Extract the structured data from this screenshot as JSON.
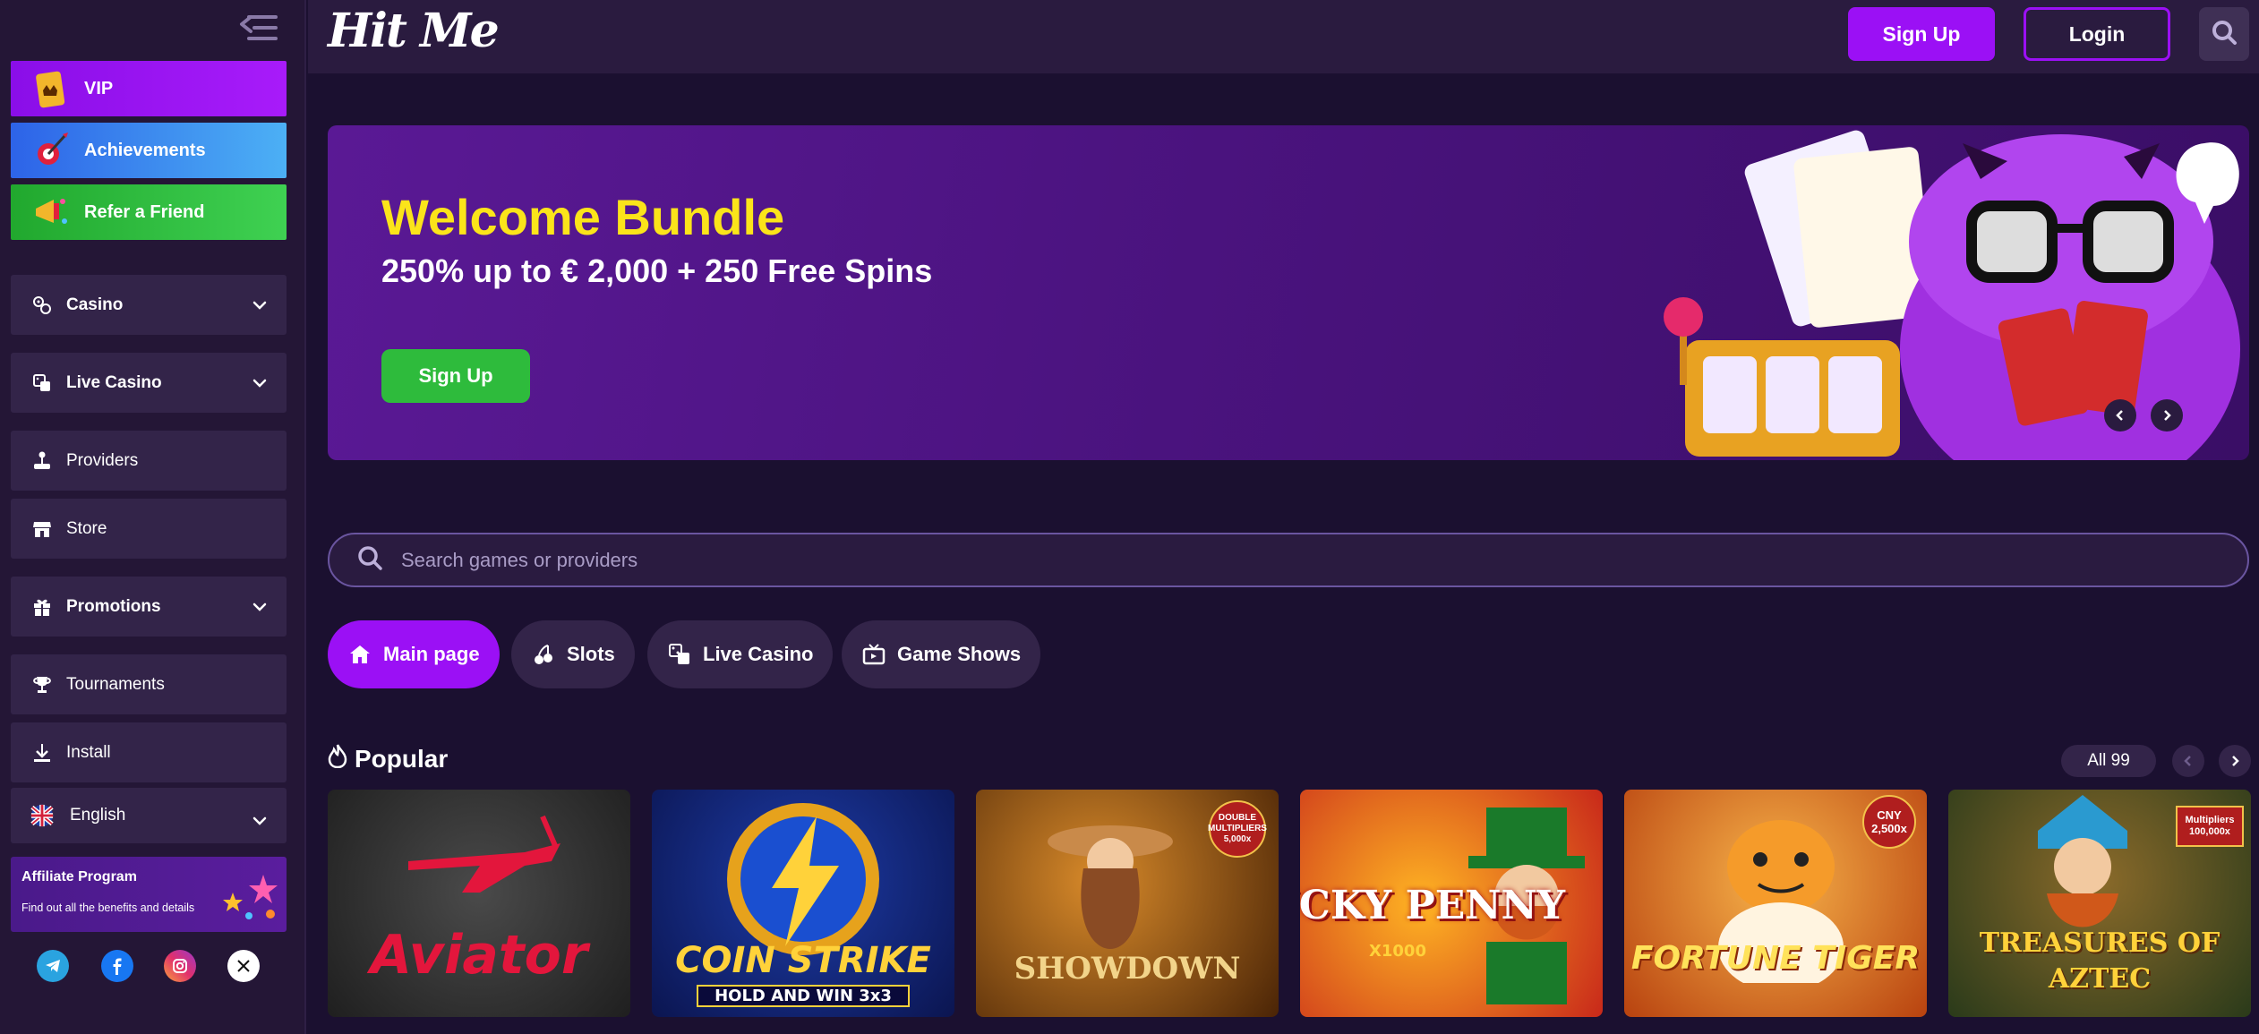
{
  "brand": {
    "logo_text": "Hit Me"
  },
  "header": {
    "signup_label": "Sign Up",
    "login_label": "Login",
    "search_icon": "search-icon"
  },
  "sidebar": {
    "promos": [
      {
        "label": "VIP",
        "icon": "vip-ticket-icon",
        "color": "#9b10f5"
      },
      {
        "label": "Achievements",
        "icon": "darts-icon",
        "color": "#3b8cf0"
      },
      {
        "label": "Refer a Friend",
        "icon": "megaphone-icon",
        "color": "#2ebb3c"
      }
    ],
    "nav": [
      {
        "label": "Casino",
        "icon": "casino-chips-icon",
        "expandable": true
      },
      {
        "label": "Live Casino",
        "icon": "dice-icon",
        "expandable": true
      },
      {
        "label": "Providers",
        "icon": "joystick-icon",
        "expandable": false
      },
      {
        "label": "Store",
        "icon": "store-icon",
        "expandable": false
      },
      {
        "label": "Promotions",
        "icon": "gift-icon",
        "expandable": true
      },
      {
        "label": "Tournaments",
        "icon": "trophy-icon",
        "expandable": false
      },
      {
        "label": "Install",
        "icon": "download-icon",
        "expandable": false
      }
    ],
    "language": {
      "label": "English",
      "icon": "uk-flag-icon"
    },
    "affiliate": {
      "title": "Affiliate Program",
      "subtitle": "Find out all the benefits and details"
    },
    "socials": [
      "telegram-icon",
      "facebook-icon",
      "instagram-icon",
      "x-icon"
    ]
  },
  "banner": {
    "title": "Welcome Bundle",
    "subtitle": "250% up to € 2,000 + 250 Free Spins",
    "cta": "Sign Up"
  },
  "search": {
    "placeholder": "Search games or providers"
  },
  "tabs": [
    {
      "label": "Main page",
      "icon": "home-icon",
      "active": true
    },
    {
      "label": "Slots",
      "icon": "cherries-icon",
      "active": false
    },
    {
      "label": "Live Casino",
      "icon": "dice-icon",
      "active": false
    },
    {
      "label": "Game Shows",
      "icon": "tv-icon",
      "active": false
    }
  ],
  "popular": {
    "title": "Popular",
    "all_label": "All 99",
    "games": [
      {
        "name": "Aviator"
      },
      {
        "name": "COIN STRIKE",
        "tagline": "HOLD AND WIN 3x3"
      },
      {
        "name": "SHOWDOWN",
        "badge": "DOUBLE MULTIPLIERS 5,000x"
      },
      {
        "name": "LUCKY PENNY",
        "tagline": "X1000"
      },
      {
        "name": "FORTUNE TIGER",
        "badge": "CNY 2,500x"
      },
      {
        "name": "TREASURES OF AZTEC",
        "badge": "Multipliers 100,000x"
      }
    ]
  },
  "colors": {
    "accent": "#9b10f5",
    "green": "#2ebb3c",
    "banner_title": "#fbe41a",
    "background": "#1b1030",
    "sidebar": "#241636"
  }
}
